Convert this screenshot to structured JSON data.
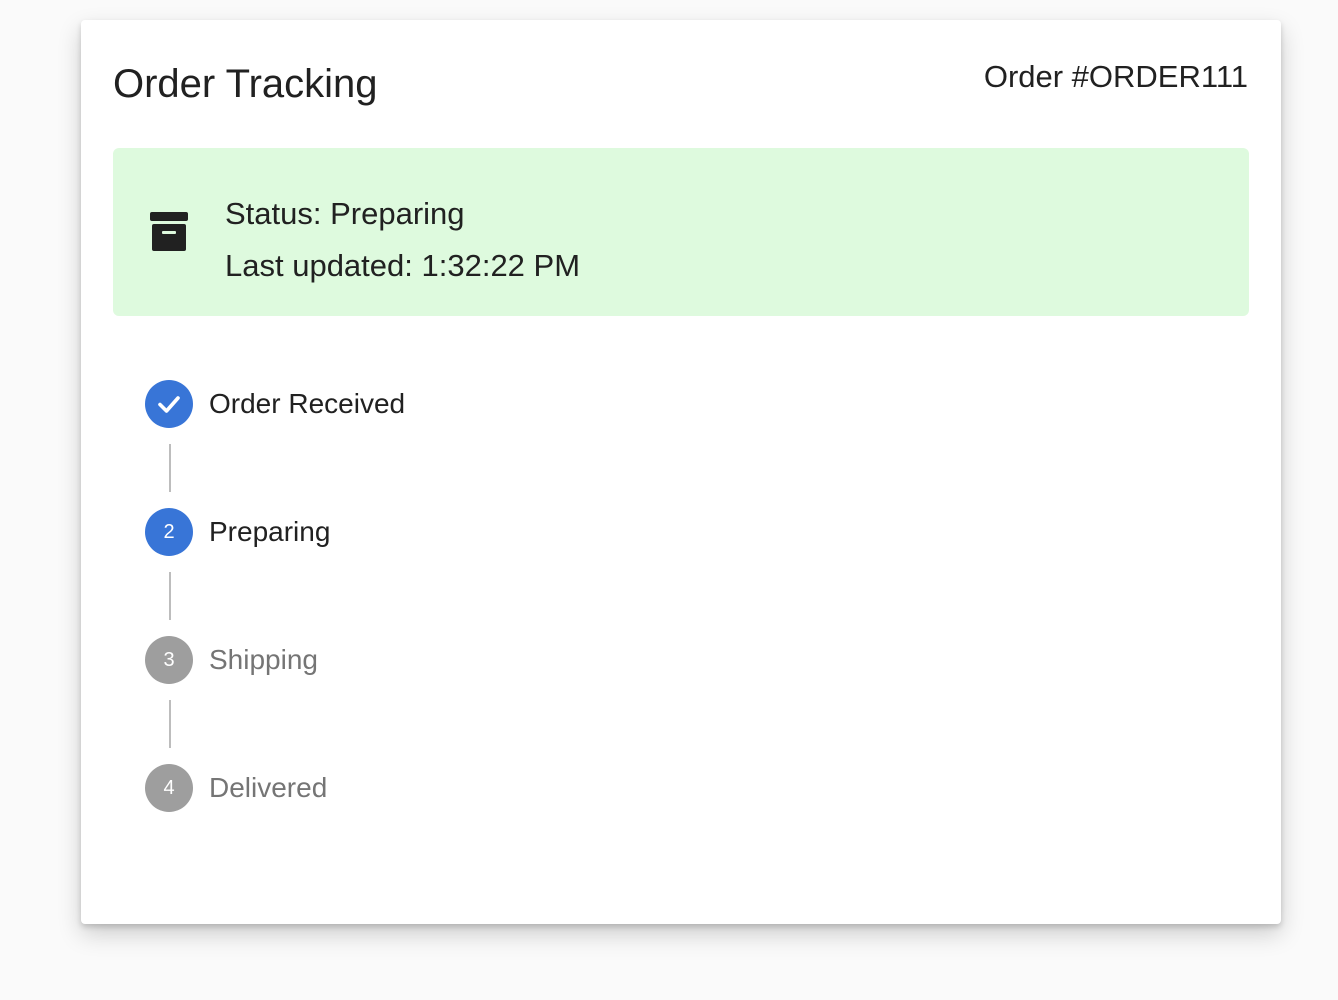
{
  "header": {
    "title": "Order Tracking",
    "order_id": "Order #ORDER111"
  },
  "status_panel": {
    "status_line": "Status: Preparing",
    "updated_line": "Last updated: 1:32:22 PM",
    "icon": "archive-box-icon",
    "background_color": "#defade"
  },
  "colors": {
    "active": "#3875d7",
    "inactive": "#9e9e9e",
    "active_text": "#212121",
    "inactive_text": "#757575"
  },
  "steps": [
    {
      "label": "Order Received",
      "number": "1",
      "state": "completed",
      "icon": "checkmark-icon"
    },
    {
      "label": "Preparing",
      "number": "2",
      "state": "active"
    },
    {
      "label": "Shipping",
      "number": "3",
      "state": "pending"
    },
    {
      "label": "Delivered",
      "number": "4",
      "state": "pending"
    }
  ]
}
